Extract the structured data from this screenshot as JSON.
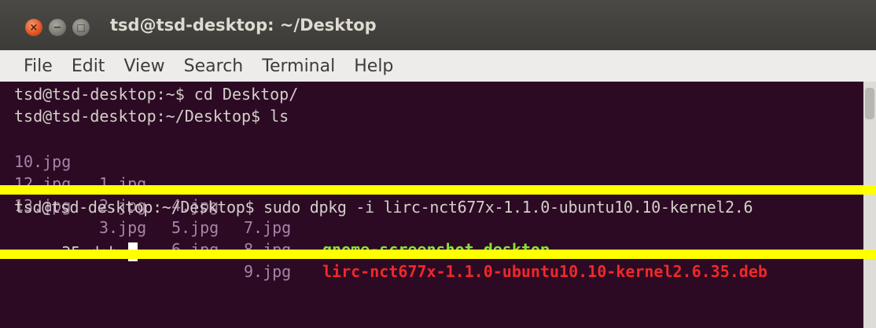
{
  "window": {
    "title": "tsd@tsd-desktop: ~/Desktop",
    "close_glyph": "×",
    "minimize_glyph": "−",
    "maximize_glyph": "□"
  },
  "menu": [
    "File",
    "Edit",
    "View",
    "Search",
    "Terminal",
    "Help"
  ],
  "terminal": {
    "line1": "tsd@tsd-desktop:~$ cd Desktop/",
    "line2": "tsd@tsd-desktop:~/Desktop$ ls",
    "ls_row1": [
      "10.jpg",
      "1.jpg",
      "4.jpg",
      "7.jpg",
      "gnome-screenshot.desktop"
    ],
    "ls_row2": [
      "12.jpg",
      "2.jpg",
      "5.jpg",
      "8.jpg",
      "lirc-nct677x-1.1.0-ubuntu10.10-kernel2.6.35.deb"
    ],
    "ls_row3": [
      "13.jpg",
      "3.jpg",
      "6.jpg",
      "9.jpg"
    ],
    "command_line": "tsd@tsd-desktop:~/Desktop$ sudo dpkg -i lirc-nct677x-1.1.0-ubuntu10.10-kernel2.6",
    "command_cont": ".35.deb "
  },
  "colors": {
    "terminal_bg": "#2c0a24",
    "terminal_text": "#d3d0c8",
    "image_file": "#a784a8",
    "executable_file": "#8ae234",
    "package_file": "#ef2929",
    "highlight": "#ffff00"
  }
}
